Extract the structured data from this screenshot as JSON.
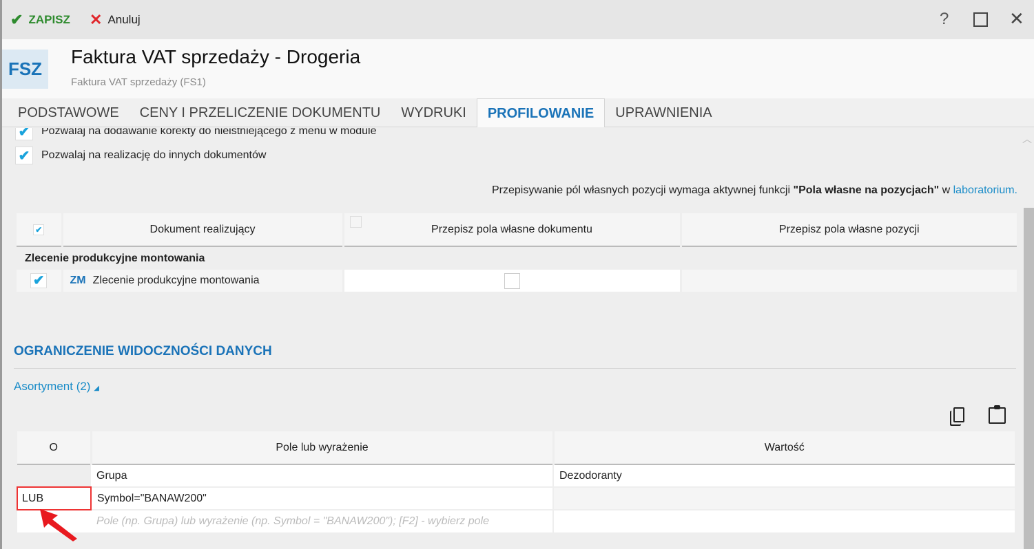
{
  "toolbar": {
    "save_label": "ZAPISZ",
    "cancel_label": "Anuluj"
  },
  "header": {
    "badge": "FSZ",
    "title": "Faktura VAT sprzedaży - Drogeria",
    "subtitle": "Faktura VAT sprzedaży (FS1)"
  },
  "tabs": [
    {
      "label": "PODSTAWOWE"
    },
    {
      "label": "CENY I PRZELICZENIE DOKUMENTU"
    },
    {
      "label": "WYDRUKI"
    },
    {
      "label": "PROFILOWANIE"
    },
    {
      "label": "UPRAWNIENIA"
    }
  ],
  "options": [
    {
      "label": "Pozwalaj na dodawanie korekty do nieistniejącego z menu w module",
      "checked": true
    },
    {
      "label": "Pozwalaj na realizację do innych dokumentów",
      "checked": true
    }
  ],
  "note": {
    "prefix": "Przepisywanie pól własnych pozycji wymaga aktywnej funkcji ",
    "bold": "\"Pola własne na pozycjach\"",
    "mid": " w ",
    "link": "laboratorium."
  },
  "realization_table": {
    "headers": [
      "Dokument realizujący",
      "Przepisz pola własne dokumentu",
      "Przepisz pola własne pozycji"
    ],
    "group": "Zlecenie produkcyjne montowania",
    "rows": [
      {
        "code": "ZM",
        "name": "Zlecenie produkcyjne montowania",
        "checked": true,
        "copy_doc_fields": false
      }
    ]
  },
  "visibility": {
    "title": "OGRANICZENIE WIDOCZNOŚCI DANYCH",
    "section": "Asortyment (2)",
    "headers": [
      "O",
      "Pole lub wyrażenie",
      "Wartość"
    ],
    "rows": [
      {
        "op": "",
        "field": "Grupa",
        "value": "Dezodoranty"
      },
      {
        "op": "LUB",
        "field": "Symbol=\"BANAW200\"",
        "value": ""
      }
    ],
    "placeholder": "Pole (np. Grupa) lub wyrażenie (np. Symbol = \"BANAW200\"); [F2] - wybierz pole"
  }
}
